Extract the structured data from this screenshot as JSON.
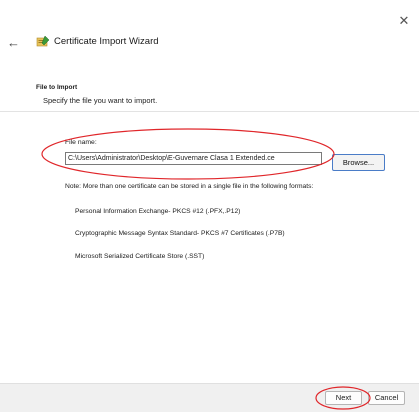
{
  "window": {
    "close_glyph": "✕",
    "back_glyph": "←",
    "title": "Certificate Import Wizard"
  },
  "section": {
    "title": "File to Import",
    "subtitle": "Specify the file you want to import."
  },
  "file": {
    "label": "File name:",
    "value": "C:\\Users\\Administrator\\Desktop\\E-Guvernare Clasa 1 Extended.ce",
    "browse_label": "Browse..."
  },
  "note": {
    "text": "Note:  More than one certificate can be stored in a single file in the following formats:",
    "formats": [
      "Personal Information Exchange- PKCS #12 (.PFX,.P12)",
      "Cryptographic Message Syntax Standard- PKCS #7 Certificates (.P7B)",
      "Microsoft Serialized Certificate Store (.SST)"
    ]
  },
  "buttons": {
    "next": "Next",
    "cancel": "Cancel"
  },
  "colors": {
    "annotation": "#e0262a",
    "browse_border": "#4a7cc7",
    "bottom_bar": "#f0f0f0"
  },
  "icons": [
    "close-icon",
    "back-arrow-icon",
    "certificate-wizard-icon"
  ]
}
